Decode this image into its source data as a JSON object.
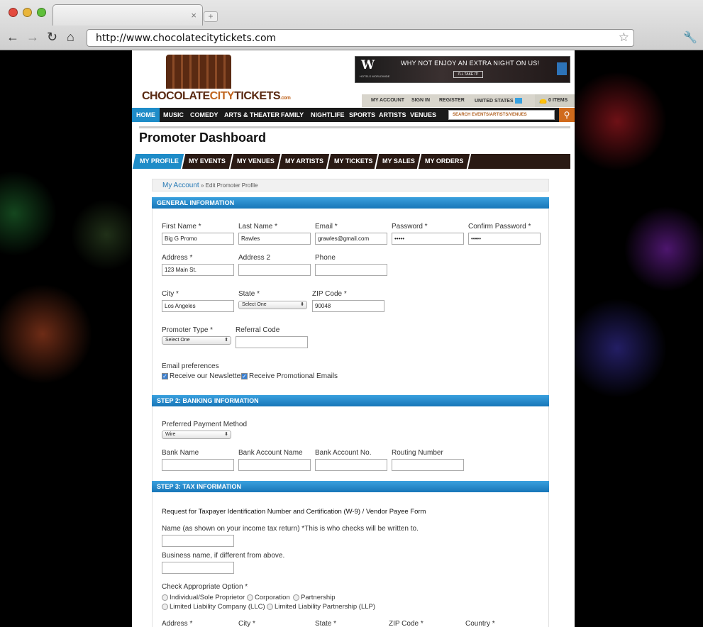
{
  "browser": {
    "url": "http://www.chocolatecitytickets.com",
    "new_tab_symbol": "+",
    "close_symbol": "×"
  },
  "header": {
    "logo_text_1": "CHOCOLATE",
    "logo_text_2": "CITY",
    "logo_text_3": "TICKETS",
    "logo_text_com": ".com",
    "banner": {
      "brand": "W",
      "sub": "HOTELS WORLDWIDE",
      "text": "WHY NOT ENJOY AN EXTRA NIGHT ON US!",
      "button": "I'LL TAKE IT!"
    },
    "top_links": [
      "MY ACCOUNT",
      "SIGN IN",
      "REGISTER"
    ],
    "country": "UNITED STATES",
    "cart": "0 ITEMS"
  },
  "nav": {
    "items": [
      "HOME",
      "MUSIC",
      "COMEDY",
      "ARTS & THEATER",
      "FAMILY",
      "NIGHTLIFE",
      "SPORTS",
      "ARTISTS",
      "VENUES"
    ],
    "search_placeholder": "SEARCH EVENTS/ARTISTS/VENUES"
  },
  "page_title": "Promoter Dashboard",
  "dash_tabs": [
    "MY PROFILE",
    "MY EVENTS",
    "MY VENUES",
    "MY ARTISTS",
    "MY TICKETS",
    "MY SALES",
    "MY ORDERS"
  ],
  "breadcrumb": {
    "link": "My Account",
    "current": "» Edit Promoter Profile"
  },
  "general": {
    "heading": "GENERAL INFORMATION",
    "first_name": {
      "label": "First Name *",
      "value": "Big G Promo"
    },
    "last_name": {
      "label": "Last Name *",
      "value": "Rawles"
    },
    "email": {
      "label": "Email *",
      "value": "grawles@gmail.com"
    },
    "password": {
      "label": "Password *",
      "value": "•••••"
    },
    "confirm": {
      "label": "Confirm Password *",
      "value": "•••••"
    },
    "address": {
      "label": "Address *",
      "value": "123 Main St."
    },
    "address2": {
      "label": "Address 2",
      "value": ""
    },
    "phone": {
      "label": "Phone",
      "value": ""
    },
    "city": {
      "label": "City *",
      "value": "Los Angeles"
    },
    "state": {
      "label": "State *",
      "value": "Select One"
    },
    "zip": {
      "label": "ZIP Code *",
      "value": "90048"
    },
    "promoter_type": {
      "label": "Promoter Type *",
      "value": "Select One"
    },
    "referral": {
      "label": "Referral Code",
      "value": ""
    },
    "prefs_label": "Email preferences",
    "newsletter": "Receive our Newsletter",
    "promo_emails": "Receive Promotional Emails"
  },
  "banking": {
    "heading": "STEP 2: BANKING INFORMATION",
    "method_label": "Preferred Payment Method",
    "method_value": "Wire",
    "bank_name": "Bank Name",
    "account_name": "Bank Account Name",
    "account_no": "Bank Account No.",
    "routing": "Routing Number"
  },
  "tax": {
    "heading": "STEP 3: TAX INFORMATION",
    "form_title": "Request for Taxpayer Identification Number and Certification (W-9) / Vendor Payee Form",
    "name_label": "Name (as shown on your income tax return) *This is who checks will be written to.",
    "business_label": "Business name, if different from above.",
    "option_label": "Check Appropriate Option *",
    "options_row1": [
      "Individual/Sole Proprietor",
      "Corporation",
      "Partnership"
    ],
    "options_row2": [
      "Limited Liability Company (LLC)",
      "Limited Liability Partnership (LLP)"
    ],
    "bottom_labels": [
      "Address *",
      "City *",
      "State *",
      "ZIP Code *",
      "Country *"
    ]
  }
}
